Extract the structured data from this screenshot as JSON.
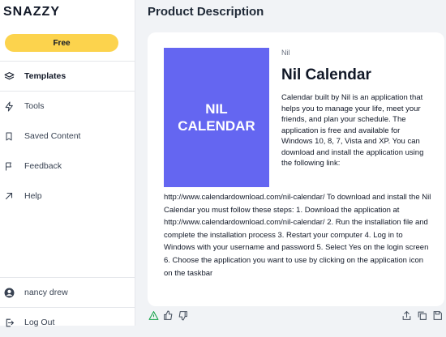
{
  "sidebar": {
    "brand": "SNAZZY",
    "plan_label": "Free",
    "items": [
      {
        "label": "Templates",
        "icon": "layers-icon"
      },
      {
        "label": "Tools",
        "icon": "bolt-icon"
      },
      {
        "label": "Saved Content",
        "icon": "bookmark-icon"
      },
      {
        "label": "Feedback",
        "icon": "flag-icon"
      },
      {
        "label": "Help",
        "icon": "arrow-up-right-icon"
      }
    ],
    "user": {
      "name": "nancy drew",
      "icon": "user-icon"
    },
    "logout": {
      "label": "Log Out",
      "icon": "logout-icon"
    }
  },
  "main": {
    "page_title": "Product Description",
    "product": {
      "cover_text": "NIL CALENDAR",
      "author": "Nil",
      "title": "Nil Calendar",
      "description_part1": "Calendar built by Nil is an application that helps you to manage your life, meet your friends, and plan your schedule. The application is free and available for Windows 10, 8, 7, Vista and XP. You can download and install the application using the following link:",
      "description_part2": "http://www.calendardownload.com/nil-calendar/ To download and install the Nil Calendar you must follow these steps: 1. Download the application at http://www.calendardownload.com/nil-calendar/ 2. Run the installation file and complete the installation process 3. Restart your computer 4. Log in to Windows with your username and password 5. Select Yes on the login screen 6. Choose the application you want to use by clicking on the application icon on the taskbar"
    },
    "actions": [
      "warning-icon",
      "thumbs-up-icon",
      "thumbs-down-icon",
      "share-icon",
      "copy-icon",
      "save-icon"
    ]
  },
  "colors": {
    "accent": "#fcd34d",
    "cover": "#6466f1",
    "warning": "#16a34a"
  }
}
